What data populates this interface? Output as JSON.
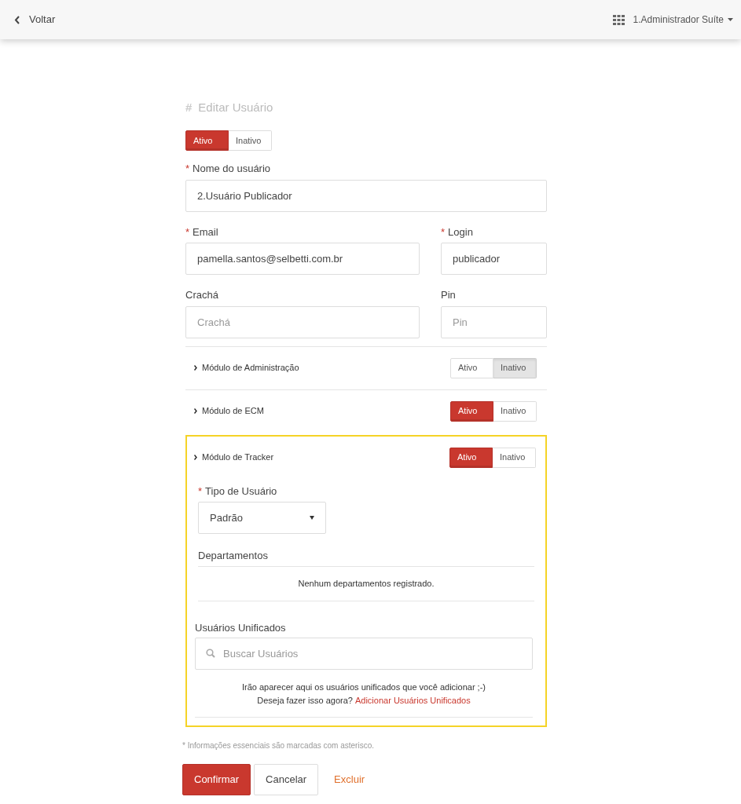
{
  "topbar": {
    "back_label": "Voltar",
    "user_menu": "1.Administrador Suíte"
  },
  "form": {
    "title": "Editar Usuário",
    "title_mark": "#",
    "status": [
      {
        "label": "Ativo",
        "kind": "active",
        "selected": true
      },
      {
        "label": "Inativo",
        "kind": "inactive",
        "selected": false
      }
    ],
    "fields": [
      {
        "label": "Nome do usuário",
        "required_mark": "*",
        "value": "2.Usuário Publicador"
      },
      {
        "label": "Email",
        "required_mark": "*",
        "value": "pamella.santos@selbetti.com.br"
      },
      {
        "label": "Login",
        "required_mark": "*",
        "value": "publicador"
      },
      {
        "label": "Crachá",
        "placeholder": "Crachá"
      },
      {
        "label": "Pin",
        "placeholder": "Pin"
      }
    ],
    "modules": [
      {
        "name": "Módulo de Administração",
        "highlighted": false,
        "options": [
          {
            "label": "Ativo",
            "kind": "active",
            "selected": false
          },
          {
            "label": "Inativo",
            "kind": "inactive",
            "selected": true
          }
        ]
      },
      {
        "name": "Módulo de ECM",
        "highlighted": false,
        "options": [
          {
            "label": "Ativo",
            "kind": "active",
            "selected": true
          },
          {
            "label": "Inativo",
            "kind": "inactive",
            "selected": false
          }
        ]
      },
      {
        "name": "Módulo de Tracker",
        "highlighted": true,
        "options": [
          {
            "label": "Ativo",
            "kind": "active",
            "selected": true
          },
          {
            "label": "Inativo",
            "kind": "inactive",
            "selected": false
          }
        ],
        "details": {
          "user_type": {
            "label": "Tipo de Usuário",
            "required_mark": "*",
            "value": "Padrão"
          },
          "departments": {
            "heading": "Departamentos",
            "empty_text": "Nenhum departamentos registrado."
          },
          "unified_users": {
            "heading": "Usuários Unificados",
            "search_placeholder": "Buscar Usuários",
            "hint": "Irão aparecer aqui os usuários unificados que você adicionar ;-)",
            "prompt": "Deseja fazer isso agora?",
            "link": "Adicionar Usuários Unificados"
          }
        }
      }
    ],
    "footnote": "* Informações essenciais são marcadas com asterisco.",
    "buttons": [
      {
        "label": "Confirmar",
        "kind": "primary"
      },
      {
        "label": "Cancelar",
        "kind": "secondary"
      },
      {
        "label": "Excluir",
        "kind": "link"
      }
    ]
  }
}
